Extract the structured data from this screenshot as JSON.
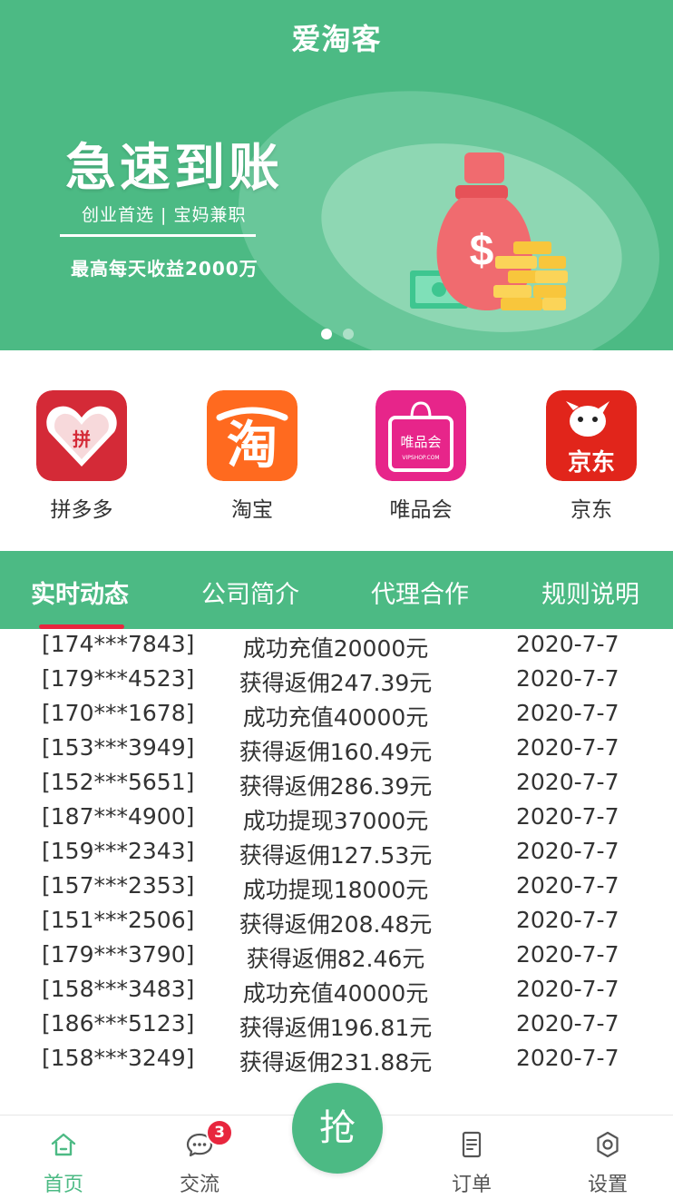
{
  "header": {
    "title": "爱淘客"
  },
  "banner": {
    "headline": "急速到账",
    "subline": "创业首选 | 宝妈兼职",
    "income": "最高每天收益2000万",
    "slide_count": 2,
    "active_slide": 1
  },
  "platforms": [
    {
      "label": "拼多多",
      "icon": "pinduoduo-logo",
      "logo_text": "拼"
    },
    {
      "label": "淘宝",
      "icon": "taobao-logo",
      "logo_text": "淘"
    },
    {
      "label": "唯品会",
      "icon": "vipshop-logo",
      "logo_text": "唯品会",
      "logo_subtext": "VIPSHOP.COM"
    },
    {
      "label": "京东",
      "icon": "jd-logo",
      "logo_text": "京东"
    }
  ],
  "tabs": [
    {
      "label": "实时动态",
      "active": true
    },
    {
      "label": "公司简介",
      "active": false
    },
    {
      "label": "代理合作",
      "active": false
    },
    {
      "label": "规则说明",
      "active": false
    }
  ],
  "feed": [
    {
      "phone": "[174***7843]",
      "action": "成功充值20000元",
      "date": "2020-7-7"
    },
    {
      "phone": "[179***4523]",
      "action": "获得返佣247.39元",
      "date": "2020-7-7"
    },
    {
      "phone": "[170***1678]",
      "action": "成功充值40000元",
      "date": "2020-7-7"
    },
    {
      "phone": "[153***3949]",
      "action": "获得返佣160.49元",
      "date": "2020-7-7"
    },
    {
      "phone": "[152***5651]",
      "action": "获得返佣286.39元",
      "date": "2020-7-7"
    },
    {
      "phone": "[187***4900]",
      "action": "成功提现37000元",
      "date": "2020-7-7"
    },
    {
      "phone": "[159***2343]",
      "action": "获得返佣127.53元",
      "date": "2020-7-7"
    },
    {
      "phone": "[157***2353]",
      "action": "成功提现18000元",
      "date": "2020-7-7"
    },
    {
      "phone": "[151***2506]",
      "action": "获得返佣208.48元",
      "date": "2020-7-7"
    },
    {
      "phone": "[179***3790]",
      "action": "获得返佣82.46元",
      "date": "2020-7-7"
    },
    {
      "phone": "[158***3483]",
      "action": "成功充值40000元",
      "date": "2020-7-7"
    },
    {
      "phone": "[186***5123]",
      "action": "获得返佣196.81元",
      "date": "2020-7-7"
    },
    {
      "phone": "[158***3249]",
      "action": "获得返佣231.88元",
      "date": "2020-7-7"
    }
  ],
  "bottom_nav": {
    "home": {
      "label": "首页",
      "icon": "home-icon",
      "active": true
    },
    "chat": {
      "label": "交流",
      "icon": "chat-bubble-icon",
      "badge": "3"
    },
    "grab": {
      "label": "抢"
    },
    "orders": {
      "label": "订单",
      "icon": "document-icon"
    },
    "settings": {
      "label": "设置",
      "icon": "gear-icon"
    }
  },
  "colors": {
    "brand_green": "#4cba84",
    "accent_red": "#e8263e",
    "text_dark": "#333333"
  }
}
